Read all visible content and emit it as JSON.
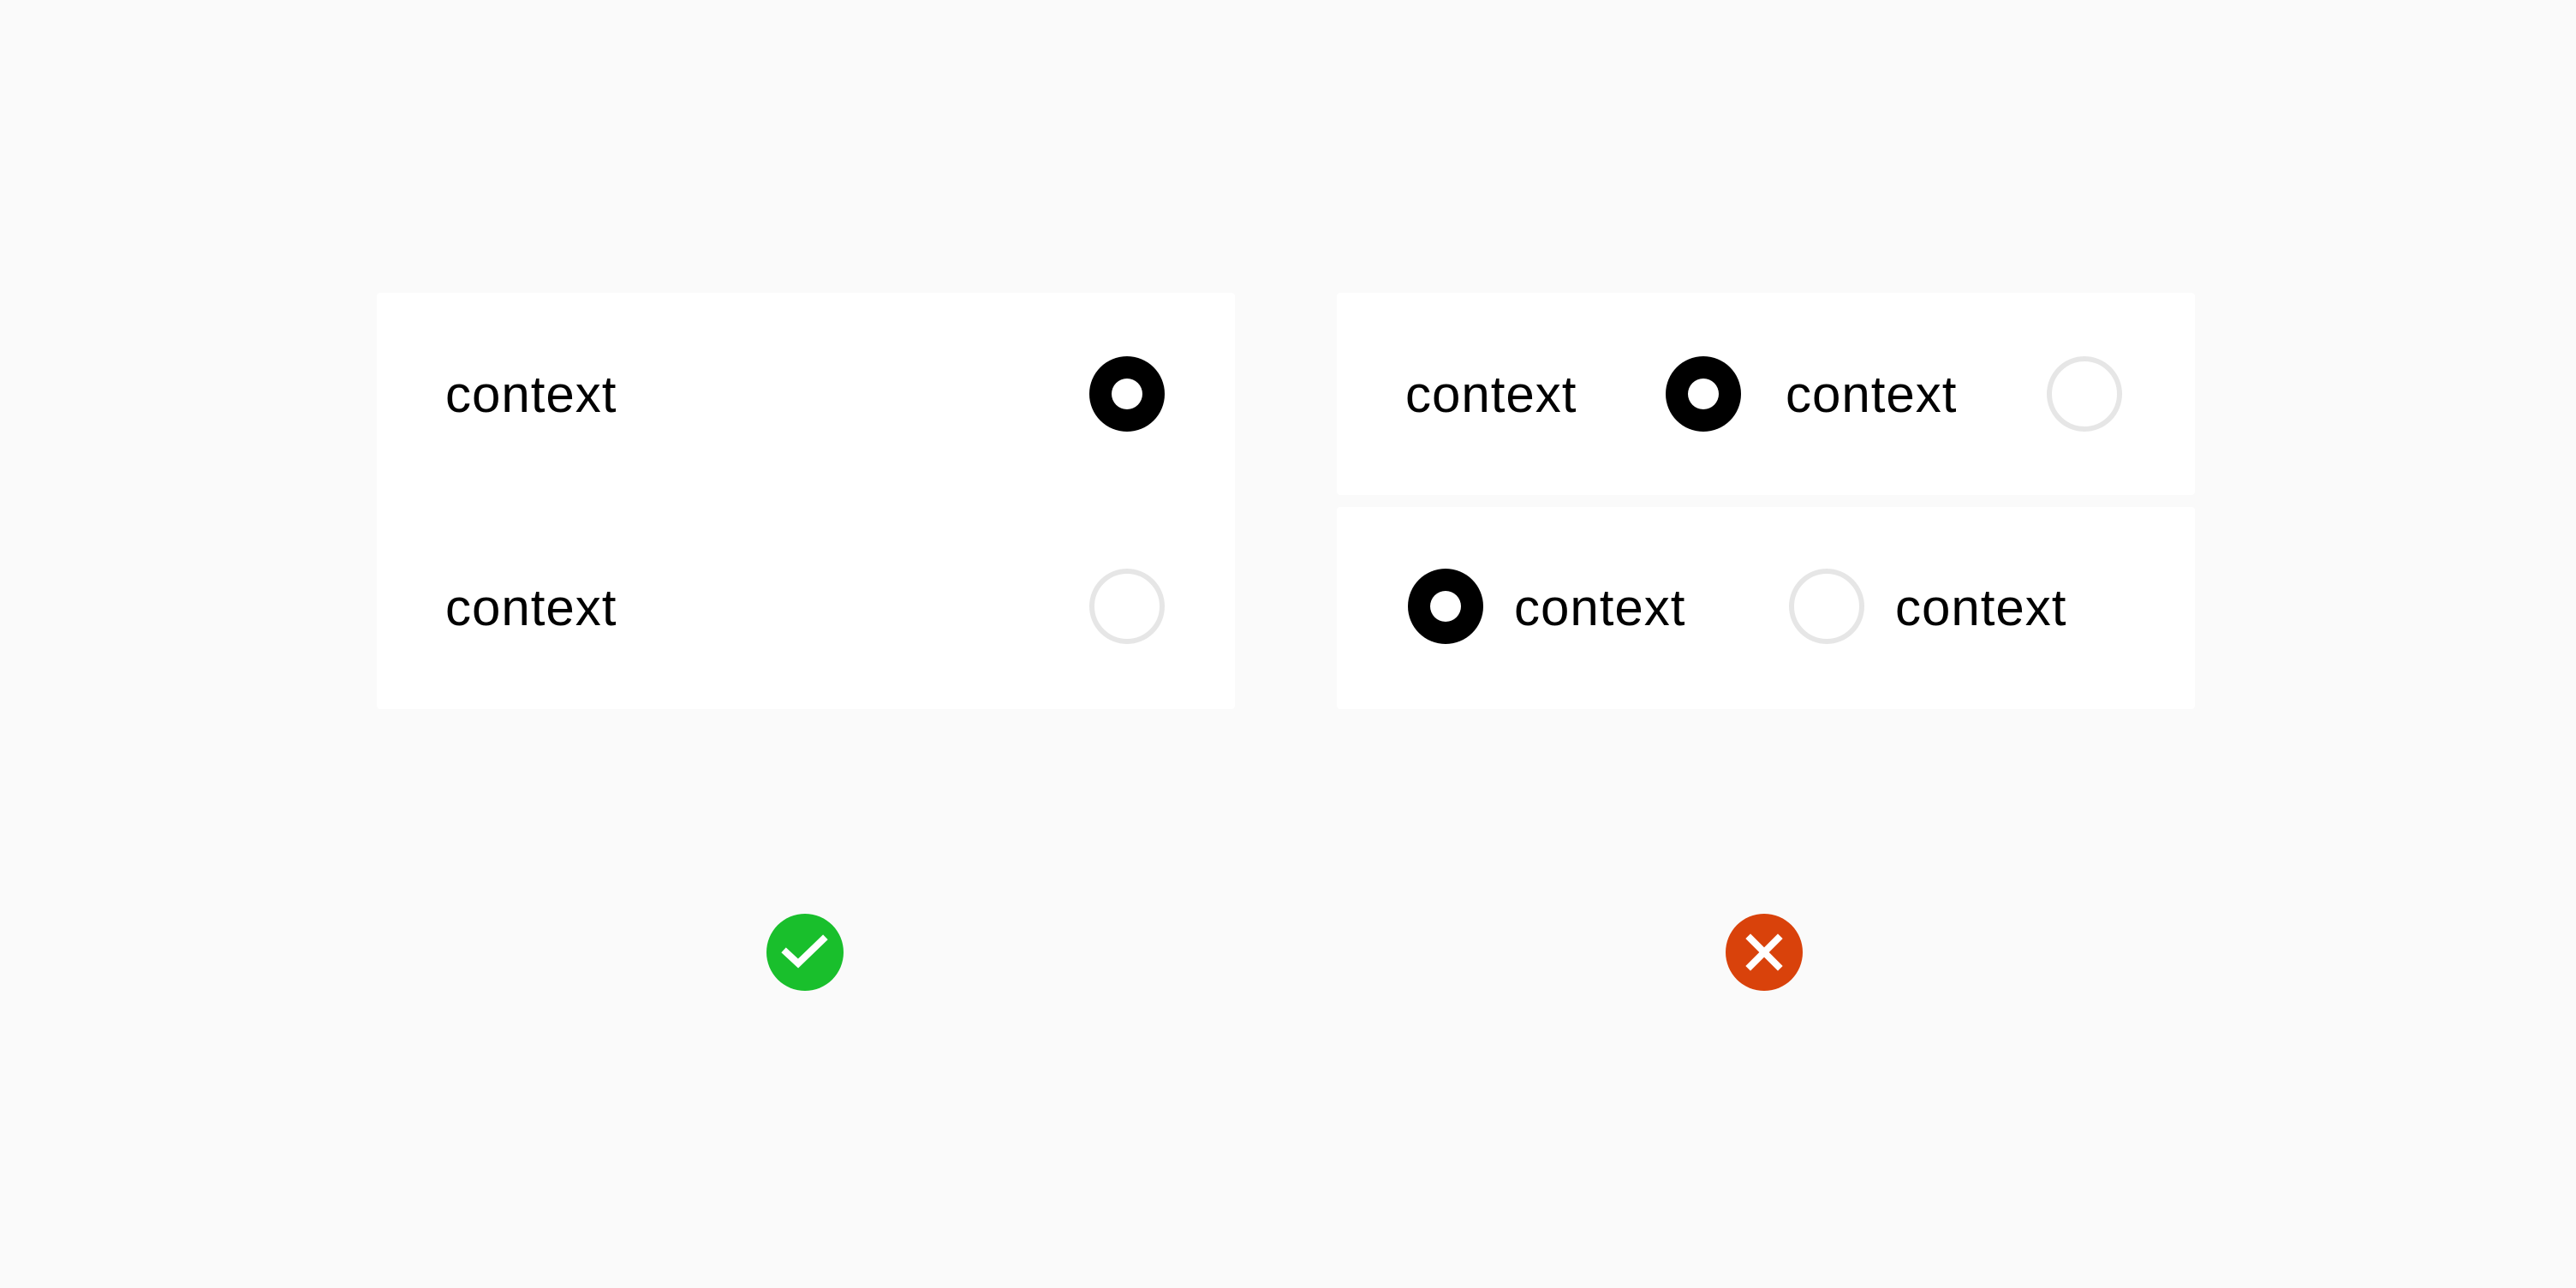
{
  "good_example": {
    "options": [
      {
        "label": "context",
        "selected": true
      },
      {
        "label": "context",
        "selected": false
      }
    ],
    "status_icon": "check-circle-icon",
    "status_color": "#19bf2c"
  },
  "bad_example": {
    "rows": [
      {
        "options": [
          {
            "label": "context",
            "selected": true
          },
          {
            "label": "context",
            "selected": false
          }
        ]
      },
      {
        "options": [
          {
            "label": "context",
            "selected": true
          },
          {
            "label": "context",
            "selected": false
          }
        ]
      }
    ],
    "status_icon": "x-circle-icon",
    "status_color": "#d9420b"
  },
  "colors": {
    "background": "#fafafa",
    "panel": "#ffffff",
    "radio_selected": "#000000",
    "radio_unselected_border": "#e6e6e6"
  }
}
